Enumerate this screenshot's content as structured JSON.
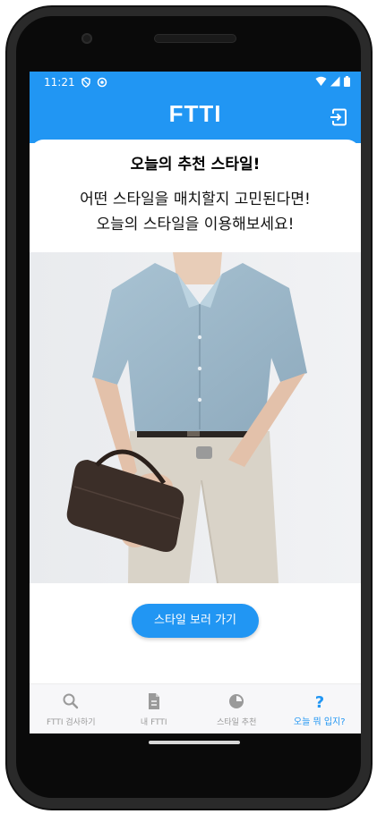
{
  "status": {
    "time": "11:21"
  },
  "app": {
    "title": "FTTI"
  },
  "content": {
    "heading": "오늘의 추천 스타일!",
    "subtitle_line1": "어떤 스타일을 매치할지 고민된다면!",
    "subtitle_line2": "오늘의 스타일을 이용해보세요!",
    "cta_label": "스타일 보러 가기"
  },
  "nav": {
    "items": [
      {
        "label": "FTTI 검사하기",
        "icon": "search-icon"
      },
      {
        "label": "내 FTTI",
        "icon": "document-icon"
      },
      {
        "label": "스타일 추천",
        "icon": "pie-chart-icon"
      },
      {
        "label": "오늘 뭐 입지?",
        "icon": "question-icon"
      }
    ]
  },
  "colors": {
    "primary": "#2196f3",
    "inactive": "#9a9a9a"
  }
}
